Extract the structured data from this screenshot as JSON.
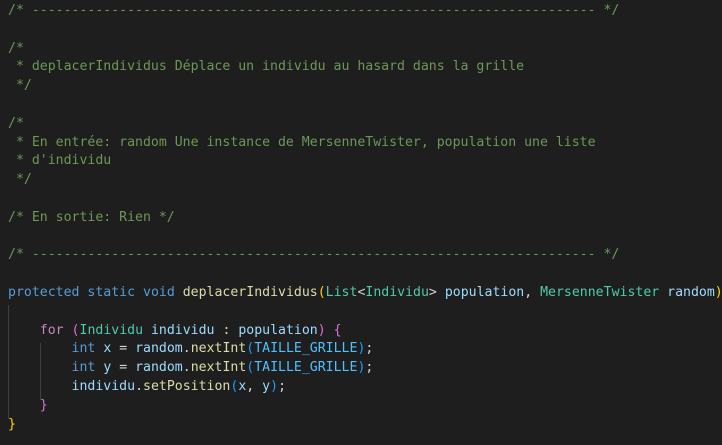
{
  "editor": {
    "lines": [
      [
        {
          "t": "/* ----------------------------------------------------------------------- */",
          "k": "c"
        }
      ],
      [],
      [
        {
          "t": "/*",
          "k": "c"
        }
      ],
      [
        {
          "t": " * deplacerIndividus Déplace un individu au hasard dans la grille",
          "k": "c"
        }
      ],
      [
        {
          "t": " */",
          "k": "c"
        }
      ],
      [],
      [
        {
          "t": "/*",
          "k": "c"
        }
      ],
      [
        {
          "t": " * En entrée: random Une instance de MersenneTwister, population une liste",
          "k": "c"
        }
      ],
      [
        {
          "t": " * d'individu",
          "k": "c"
        }
      ],
      [
        {
          "t": " */",
          "k": "c"
        }
      ],
      [],
      [
        {
          "t": "/* En sortie: Rien */",
          "k": "c"
        }
      ],
      [],
      [
        {
          "t": "/* ----------------------------------------------------------------------- */",
          "k": "c"
        }
      ],
      [],
      [
        {
          "t": "protected",
          "k": "kw"
        },
        {
          "t": " ",
          "k": "pn"
        },
        {
          "t": "static",
          "k": "kw"
        },
        {
          "t": " ",
          "k": "pn"
        },
        {
          "t": "void",
          "k": "kw"
        },
        {
          "t": " ",
          "k": "pn"
        },
        {
          "t": "deplacerIndividus",
          "k": "fn"
        },
        {
          "t": "(",
          "k": "b1"
        },
        {
          "t": "List",
          "k": "ty"
        },
        {
          "t": "<",
          "k": "pn"
        },
        {
          "t": "Individu",
          "k": "ty"
        },
        {
          "t": "> ",
          "k": "pn"
        },
        {
          "t": "population",
          "k": "var"
        },
        {
          "t": ", ",
          "k": "pn"
        },
        {
          "t": "MersenneTwister",
          "k": "ty"
        },
        {
          "t": " ",
          "k": "pn"
        },
        {
          "t": "random",
          "k": "var"
        },
        {
          "t": ")",
          "k": "b1"
        },
        {
          "t": " ",
          "k": "pn"
        },
        {
          "t": "{",
          "k": "b1"
        }
      ],
      [],
      [
        {
          "t": "    ",
          "k": "pn"
        },
        {
          "t": "for",
          "k": "ctl"
        },
        {
          "t": " ",
          "k": "pn"
        },
        {
          "t": "(",
          "k": "b2"
        },
        {
          "t": "Individu",
          "k": "ty"
        },
        {
          "t": " ",
          "k": "pn"
        },
        {
          "t": "individu",
          "k": "var"
        },
        {
          "t": " : ",
          "k": "pn"
        },
        {
          "t": "population",
          "k": "var"
        },
        {
          "t": ")",
          "k": "b2"
        },
        {
          "t": " ",
          "k": "pn"
        },
        {
          "t": "{",
          "k": "b2"
        }
      ],
      [
        {
          "t": "        ",
          "k": "pn"
        },
        {
          "t": "int",
          "k": "kw"
        },
        {
          "t": " ",
          "k": "pn"
        },
        {
          "t": "x",
          "k": "var"
        },
        {
          "t": " = ",
          "k": "pn"
        },
        {
          "t": "random",
          "k": "var"
        },
        {
          "t": ".",
          "k": "pn"
        },
        {
          "t": "nextInt",
          "k": "fn"
        },
        {
          "t": "(",
          "k": "b3"
        },
        {
          "t": "TAILLE_GRILLE",
          "k": "cst"
        },
        {
          "t": ")",
          "k": "b3"
        },
        {
          "t": ";",
          "k": "pn"
        }
      ],
      [
        {
          "t": "        ",
          "k": "pn"
        },
        {
          "t": "int",
          "k": "kw"
        },
        {
          "t": " ",
          "k": "pn"
        },
        {
          "t": "y",
          "k": "var"
        },
        {
          "t": " = ",
          "k": "pn"
        },
        {
          "t": "random",
          "k": "var"
        },
        {
          "t": ".",
          "k": "pn"
        },
        {
          "t": "nextInt",
          "k": "fn"
        },
        {
          "t": "(",
          "k": "b3"
        },
        {
          "t": "TAILLE_GRILLE",
          "k": "cst"
        },
        {
          "t": ")",
          "k": "b3"
        },
        {
          "t": ";",
          "k": "pn"
        }
      ],
      [
        {
          "t": "        ",
          "k": "pn"
        },
        {
          "t": "individu",
          "k": "var"
        },
        {
          "t": ".",
          "k": "pn"
        },
        {
          "t": "setPosition",
          "k": "fn"
        },
        {
          "t": "(",
          "k": "b3"
        },
        {
          "t": "x",
          "k": "var"
        },
        {
          "t": ", ",
          "k": "pn"
        },
        {
          "t": "y",
          "k": "var"
        },
        {
          "t": ")",
          "k": "b3"
        },
        {
          "t": ";",
          "k": "pn"
        }
      ],
      [
        {
          "t": "    ",
          "k": "pn"
        },
        {
          "t": "}",
          "k": "b2"
        }
      ],
      [
        {
          "t": "}",
          "k": "b1"
        }
      ]
    ]
  },
  "theme": {
    "background": "#1e1e1e",
    "comment": "#6a9955",
    "keyword": "#569cd6",
    "control": "#c586c0",
    "type": "#4ec9b0",
    "function": "#dcdcaa",
    "variable": "#9cdcfe",
    "constant": "#4fc1ff",
    "bracket_level_1": "#ffd700",
    "bracket_level_2": "#da70d6",
    "bracket_level_3": "#179fff"
  }
}
